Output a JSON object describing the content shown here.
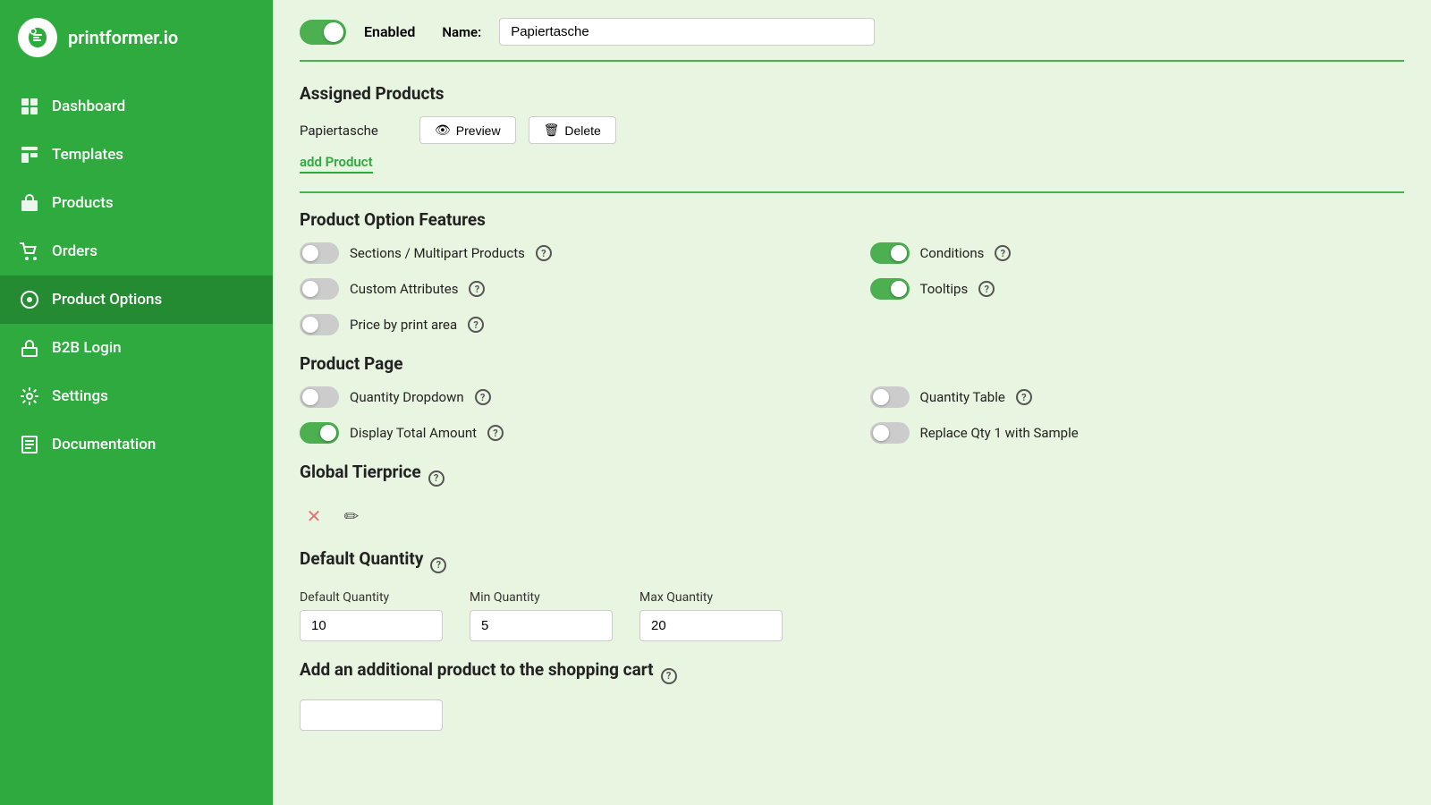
{
  "sidebar": {
    "logo_text": "printformer.io",
    "items": [
      {
        "id": "dashboard",
        "label": "Dashboard",
        "icon": "dashboard"
      },
      {
        "id": "templates",
        "label": "Templates",
        "icon": "templates"
      },
      {
        "id": "products",
        "label": "Products",
        "icon": "products"
      },
      {
        "id": "orders",
        "label": "Orders",
        "icon": "orders"
      },
      {
        "id": "product-options",
        "label": "Product Options",
        "icon": "product-options",
        "active": true
      },
      {
        "id": "b2b-login",
        "label": "B2B Login",
        "icon": "b2b"
      },
      {
        "id": "settings",
        "label": "Settings",
        "icon": "settings"
      },
      {
        "id": "documentation",
        "label": "Documentation",
        "icon": "docs"
      }
    ]
  },
  "topbar": {
    "enabled_label": "Enabled",
    "name_label": "Name:",
    "name_value": "Papiertasche",
    "toggle_on": true
  },
  "assigned_products": {
    "section_title": "Assigned Products",
    "product_name": "Papiertasche",
    "preview_btn": "Preview",
    "delete_btn": "Delete",
    "add_product_link": "add Product"
  },
  "features": {
    "section_title": "Product Option Features",
    "items": [
      {
        "id": "sections",
        "label": "Sections / Multipart Products",
        "enabled": false,
        "side": "left"
      },
      {
        "id": "conditions",
        "label": "Conditions",
        "enabled": true,
        "side": "right"
      },
      {
        "id": "custom-attrs",
        "label": "Custom Attributes",
        "enabled": false,
        "side": "left"
      },
      {
        "id": "tooltips",
        "label": "Tooltips",
        "enabled": true,
        "side": "right"
      },
      {
        "id": "price-by-area",
        "label": "Price by print area",
        "enabled": false,
        "side": "left"
      }
    ]
  },
  "product_page": {
    "section_title": "Product Page",
    "items": [
      {
        "id": "qty-dropdown",
        "label": "Quantity Dropdown",
        "enabled": false,
        "side": "left"
      },
      {
        "id": "qty-table",
        "label": "Quantity Table",
        "enabled": false,
        "side": "right"
      },
      {
        "id": "display-total",
        "label": "Display Total Amount",
        "enabled": true,
        "side": "left"
      },
      {
        "id": "replace-qty",
        "label": "Replace Qty 1 with Sample",
        "enabled": false,
        "side": "right"
      }
    ]
  },
  "tierprice": {
    "section_title": "Global Tierprice"
  },
  "default_quantity": {
    "section_title": "Default Quantity",
    "fields": [
      {
        "id": "default-qty",
        "label": "Default Quantity",
        "value": "10"
      },
      {
        "id": "min-qty",
        "label": "Min Quantity",
        "value": "5"
      },
      {
        "id": "max-qty",
        "label": "Max Quantity",
        "value": "20"
      }
    ]
  },
  "additional_product": {
    "section_title": "Add an additional product to the shopping cart",
    "input_value": ""
  }
}
